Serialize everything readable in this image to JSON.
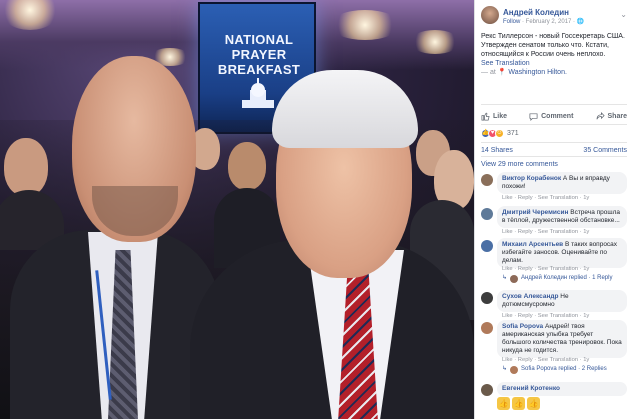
{
  "photo": {
    "screen_line1": "NATIONAL PRAYER",
    "screen_line2": "BREAKFAST"
  },
  "post": {
    "author": "Андрей Коледин",
    "follow": "Follow",
    "date": "· February 2, 2017 ·",
    "text": "Рекс Тиллерсон - новый Госсекретарь США. Утвержден сенатом только что. Кстати, относящийся к России очень неплохо.",
    "see_translation": "See Translation",
    "checkin_prefix": "— at",
    "location": "Washington Hilton."
  },
  "actions": {
    "like": "Like",
    "comment": "Comment",
    "share": "Share"
  },
  "reactions": {
    "count": "371",
    "colors": {
      "like": "#4267b2",
      "love": "#f25268",
      "haha": "#f7b125"
    }
  },
  "stats": {
    "shares": "14 Shares",
    "comments": "35 Comments",
    "view_more": "View 29 more comments"
  },
  "comments": [
    {
      "name": "Виктор Корабенок",
      "text": "А Вы и вправду похожи!",
      "meta": "Like · Reply · See Translation · 1y",
      "color": "#8a6f5a"
    },
    {
      "name": "Дмитрий Черемисин",
      "text": "Встреча прошла в тёплой, дружественной обстановке...",
      "meta": "Like · Reply · See Translation · 1y",
      "color": "#5f7a99"
    },
    {
      "name": "Михаил Арсентьев",
      "text": "В таких вопросах избегайте заносов. Оценивайте по делам.",
      "meta": "Like · Reply · See Translation · 1y",
      "color": "#4a6fa5",
      "reply_text": "Андрей Коледин replied · 1 Reply"
    },
    {
      "name": "Сухов Александр",
      "text": "Не дотюмсмусромно",
      "meta": "Like · Reply · See Translation · 1y",
      "color": "#3d3d3d"
    },
    {
      "name": "Sofia Popova",
      "text": "Андрей! твоя американская улыбка требует большого количества тренировок. Пока никуда не годится.",
      "meta": "Like · Reply · See Translation · 1y",
      "color": "#b07a5a",
      "reply_text": "Sofia Popova replied · 2 Replies"
    },
    {
      "name": "Евгений Кротенко",
      "text": "",
      "meta": "",
      "color": "#6a5a4a"
    }
  ],
  "last_comment_thumbs": "👍👍👍"
}
